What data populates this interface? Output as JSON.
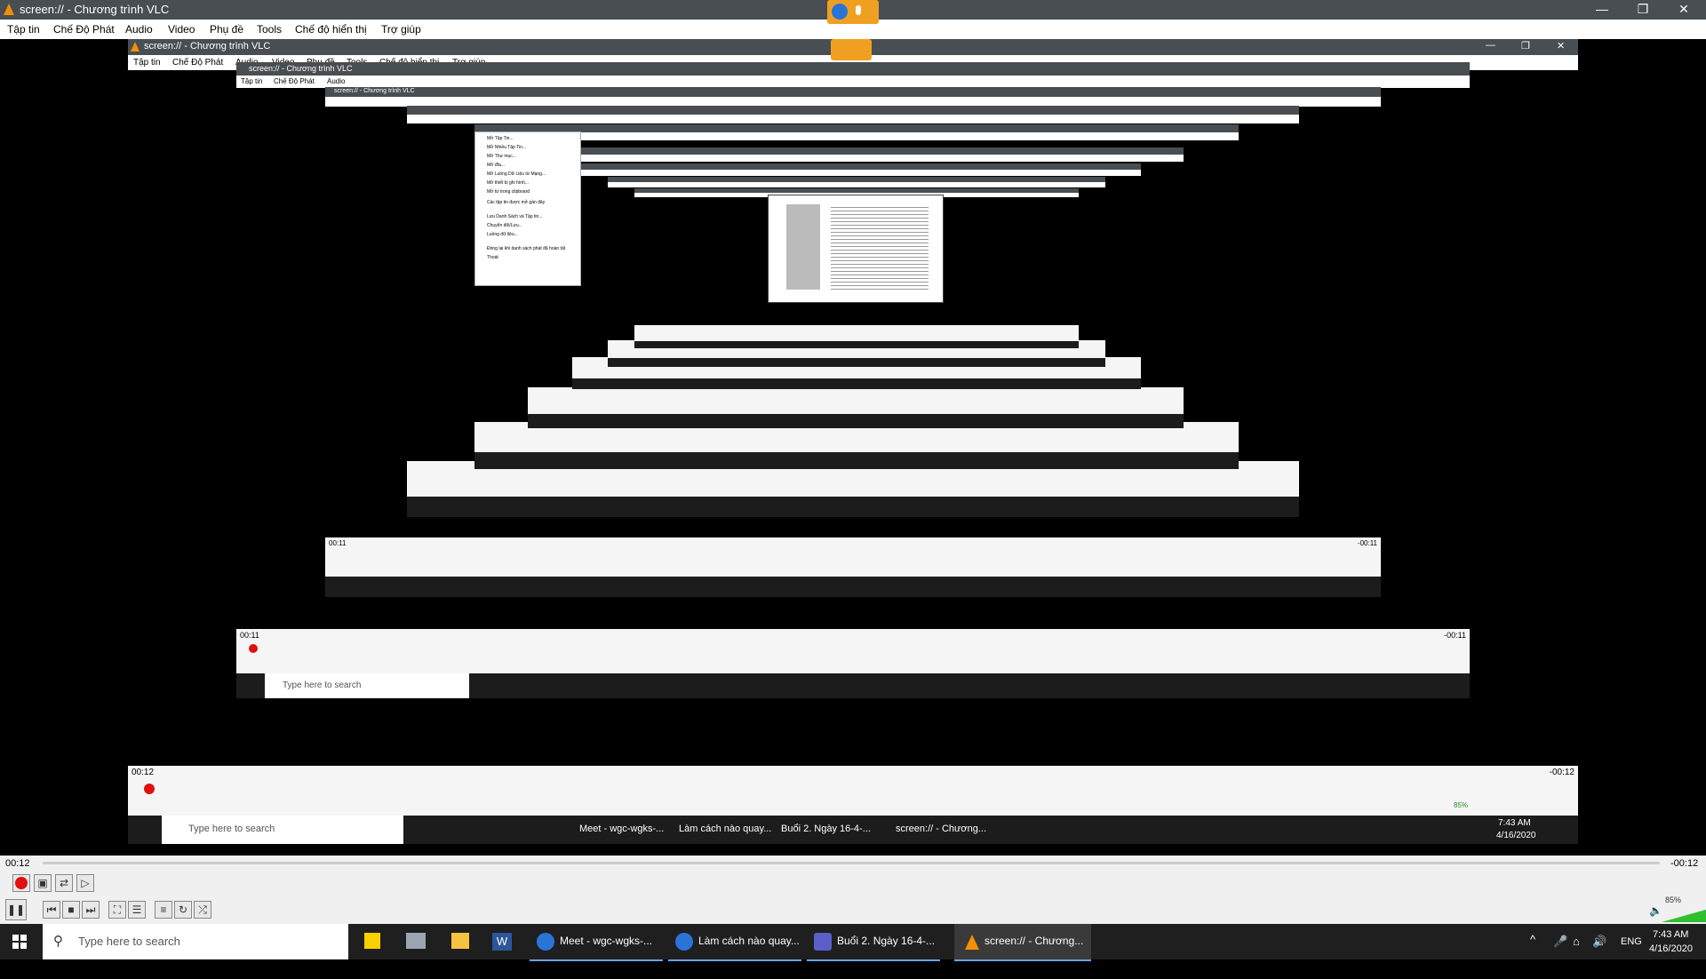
{
  "window": {
    "title": "screen:// - Chương trình VLC",
    "controls": [
      "—",
      "❐",
      "✕"
    ]
  },
  "menu": [
    "Tập tin",
    "Chế Độ Phát",
    "Audio",
    "Video",
    "Phụ đề",
    "Tools",
    "Chế độ hiển thị",
    "Trợ giúp"
  ],
  "playback": {
    "elapsed": "00:12",
    "remaining": "-00:12",
    "volume": "85%",
    "volume_level": 0.85
  },
  "nested_mirror": {
    "title": "screen:// - Chương trình VLC",
    "elapsed": "00:11",
    "remaining": "-00:11",
    "file_menu": [
      "Mở Tập Tin...",
      "Mở Nhiều Tập Tin...",
      "Mở Thư mục...",
      "Mở đĩa...",
      "Mở Luồng Dữ Liệu từ Mạng...",
      "Mở thiết bị ghi hình...",
      "Mở từ trong clipboard",
      "Các tập tin được mở gần đây",
      "Lưu Danh Sách và Tập tin...",
      "Chuyển đổi/Lưu...",
      "Luồng dữ liệu...",
      "Đóng lại khi danh sách phát đã hoàn tất",
      "Thoát"
    ]
  },
  "taskbar": {
    "search_placeholder": "Type here to search",
    "apps": [
      {
        "label": "Meet - wgc-wgks-...",
        "icon": "chrome-icon",
        "color": "#2a74d8"
      },
      {
        "label": "Làm cách nào quay...",
        "icon": "chrome-icon",
        "color": "#2a74d8"
      },
      {
        "label": "Buổi 2. Ngày 16-4-...",
        "icon": "teams-icon",
        "color": "#5b5fc7"
      },
      {
        "label": "screen:// - Chương...",
        "icon": "vlc-icon",
        "color": "#f29100"
      }
    ],
    "lang": "ENG",
    "time": "7:43 AM",
    "date": "4/16/2020"
  }
}
